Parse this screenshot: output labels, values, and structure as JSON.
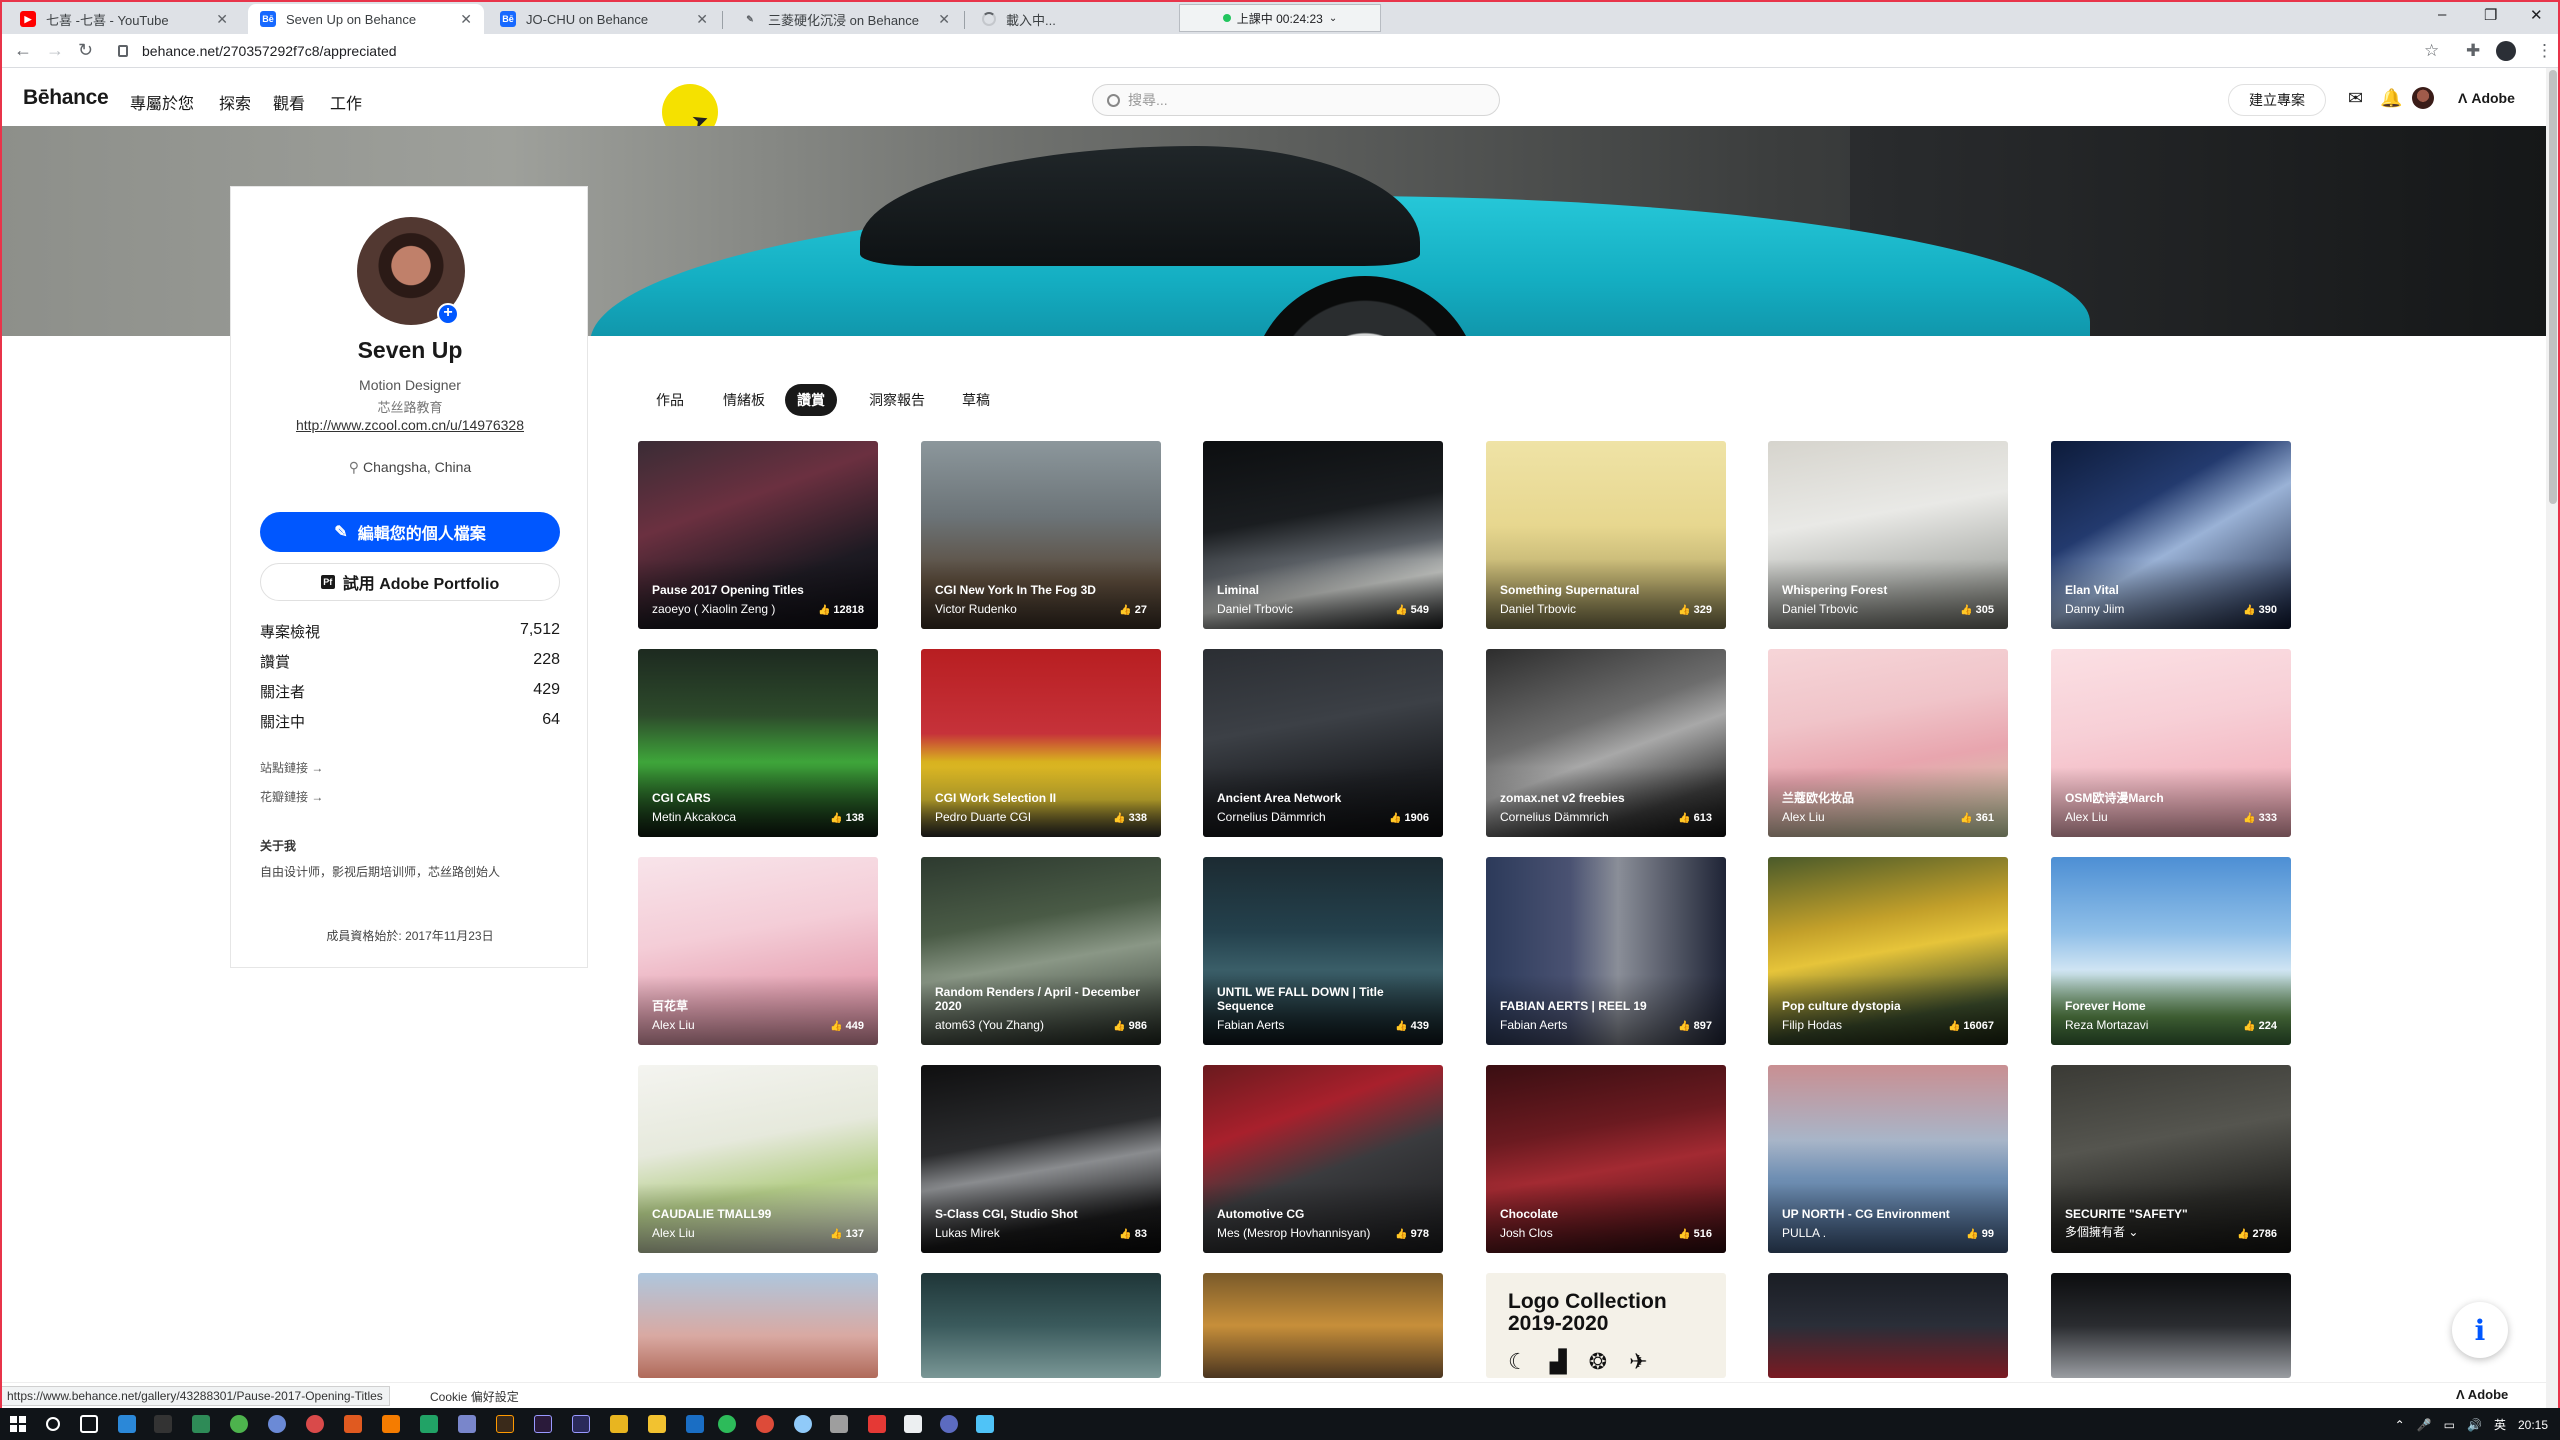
{
  "browser": {
    "tabs": [
      {
        "label": "七喜 -七喜 - YouTube",
        "favicon": "youtube-icon",
        "color": "#ff0000"
      },
      {
        "label": "Seven Up on Behance",
        "favicon": "behance-icon",
        "color": "#1769ff"
      },
      {
        "label": "JO-CHU on Behance",
        "favicon": "behance-icon",
        "color": "#1769ff"
      },
      {
        "label": "三菱硬化沉浸 on Behance",
        "favicon": "behance-icon",
        "color": "#1769ff"
      },
      {
        "label": "載入中...",
        "favicon": "loading-spinner"
      }
    ],
    "recording": "上課中 00:24:23",
    "url": "behance.net/270357292f7c8/appreciated",
    "status_url": "https://www.behance.net/gallery/43288301/Pause-2017-Opening-Titles"
  },
  "header": {
    "logo": "Bēhance",
    "nav": [
      "專屬於您",
      "探索",
      "觀看",
      "工作"
    ],
    "search_placeholder": "搜尋...",
    "create_label": "建立專案",
    "adobe_label": "Adobe"
  },
  "profile": {
    "name": "Seven Up",
    "occupation": "Motion Designer",
    "company": "芯丝路教育",
    "link": "http://www.zcool.com.cn/u/14976328",
    "location": "Changsha, China",
    "edit_label": "編輯您的個人檔案",
    "portfolio_label": "試用 Adobe Portfolio",
    "stats": [
      {
        "label": "專案檢視",
        "value": "7,512"
      },
      {
        "label": "讚賞",
        "value": "228"
      },
      {
        "label": "關注者",
        "value": "429"
      },
      {
        "label": "關注中",
        "value": "64"
      }
    ],
    "site_link": "站點鏈接 →",
    "flower_link": "花瓣鏈接 →",
    "about_heading": "关于我",
    "about_text": "自由设计师，影视后期培训师，芯丝路创始人",
    "member_since": "成員資格始於: 2017年11月23日"
  },
  "tabs": [
    "作品",
    "情緒板",
    "讚賞",
    "洞察報告",
    "草稿"
  ],
  "active_tab": "讚賞",
  "gallery": [
    {
      "title": "Pause 2017 Opening Titles",
      "author": "zaoeyo ( Xiaolin Zeng )",
      "likes": "12818",
      "bg": "linear-gradient(160deg,#3a2c35 0%,#6b3040 35%,#1d1a22 70%,#0d0c12 100%)"
    },
    {
      "title": "CGI New York In The Fog 3D",
      "author": "Victor Rudenko",
      "likes": "27",
      "bg": "linear-gradient(180deg,#8c979c 0%,#6c7478 40%,#5a4a3a 75%,#3b3026 100%)"
    },
    {
      "title": "Liminal",
      "author": "Daniel Trbovic",
      "likes": "549",
      "bg": "linear-gradient(170deg,#0c0e10 0%,#1a1d20 40%,#5b6066 60%,#c7c9c6 75%,#181a1c 100%)"
    },
    {
      "title": "Something Supernatural",
      "author": "Daniel Trbovic",
      "likes": "329",
      "bg": "linear-gradient(180deg,#efe3a6 0%,#e7d78f 45%,#bcae6e 75%,#7f774c 100%)"
    },
    {
      "title": "Whispering Forest",
      "author": "Daniel Trbovic",
      "likes": "305",
      "bg": "linear-gradient(170deg,#d6d4cd 0%,#e9e9e6 40%,#b3b5b1 70%,#6a6b63 100%)"
    },
    {
      "title": "Elan Vital",
      "author": "Danny Jiim",
      "likes": "390",
      "bg": "linear-gradient(150deg,#0d1b3a 0%,#233a6e 35%,#9ab2d6 55%,#0c1631 100%)"
    },
    {
      "title": "CGI CARS",
      "author": "Metin Akcakoca",
      "likes": "138",
      "bg": "linear-gradient(180deg,#1d2a20 0%,#2d4a2b 35%,#3ea53a 60%,#0f1a10 100%)"
    },
    {
      "title": "CGI Work Selection II",
      "author": "Pedro Duarte CGI",
      "likes": "338",
      "bg": "linear-gradient(180deg,#b81e21 0%,#c6323a 45%,#d8b21f 60%,#e0c433 80%,#2b2b2b 100%)"
    },
    {
      "title": "Ancient Area Network",
      "author": "Cornelius Dämmrich",
      "likes": "1906",
      "bg": "linear-gradient(170deg,#2b2e33 0%,#3c4046 40%,#1d1f23 70%,#0d0e10 100%)"
    },
    {
      "title": "zomax.net v2 freebies",
      "author": "Cornelius Dämmrich",
      "likes": "613",
      "bg": "linear-gradient(160deg,#2d2d2d 0%,#6d6d6d 40%,#a8a8a8 55%,#3a3a3a 80%,#101010 100%)"
    },
    {
      "title": "兰蔻欧化妆品",
      "author": "Alex Liu",
      "likes": "361",
      "bg": "linear-gradient(170deg,#f6d5d8 0%,#f0c4c9 35%,#e8a5ae 60%,#c9d7a8 100%)"
    },
    {
      "title": "OSM欧诗漫March",
      "author": "Alex Liu",
      "likes": "333",
      "bg": "linear-gradient(170deg,#fbe0e4 0%,#f7cfd6 40%,#f3b9c3 70%,#e9a2ae 100%)"
    },
    {
      "title": "百花草",
      "author": "Alex Liu",
      "likes": "449",
      "bg": "linear-gradient(170deg,#f8e4ea 0%,#f4cdd7 40%,#e7a6b6 70%,#d88fa1 100%)"
    },
    {
      "title": "Random Renders / April - December 2020",
      "author": "atom63 (You Zhang)",
      "likes": "986",
      "bg": "linear-gradient(170deg,#2d3a2f 0%,#4a5b46 35%,#8a9786 55%,#1f261f 100%)"
    },
    {
      "title": "UNTIL WE FALL DOWN | Title Sequence",
      "author": "Fabian Aerts",
      "likes": "439",
      "bg": "linear-gradient(180deg,#1c2b32 0%,#24414d 40%,#3a5e68 60%,#0d161a 100%)"
    },
    {
      "title": "FABIAN AERTS | REEL 19",
      "author": "Fabian Aerts",
      "likes": "897",
      "bg": "linear-gradient(90deg,#2c3a5a 0%,#4a5272 35%,#8a8e98 55%,#1f2436 100%)"
    },
    {
      "title": "Pop culture dystopia",
      "author": "Filip Hodas",
      "likes": "16067",
      "bg": "linear-gradient(170deg,#4a5a2a 0%,#c3a02a 35%,#e6c43a 50%,#3a4a2a 80%,#1a2210 100%)"
    },
    {
      "title": "Forever Home",
      "author": "Reza Mortazavi",
      "likes": "224",
      "bg": "linear-gradient(180deg,#4d8fd4 0%,#8fbfe8 40%,#cfe4f3 60%,#5b8a4a 85%,#3a6a3a 100%)"
    },
    {
      "title": "CAUDALIE TMALL99",
      "author": "Alex Liu",
      "likes": "137",
      "bg": "linear-gradient(170deg,#f4f4f0 0%,#e6e9dc 40%,#b6cf8a 65%,#d9d8d2 100%)"
    },
    {
      "title": "S-Class CGI, Studio Shot",
      "author": "Lukas Mirek",
      "likes": "83",
      "bg": "linear-gradient(170deg,#0f0f10 0%,#2b2c2e 40%,#8a8c8f 55%,#1a1a1b 80%,#0a0a0a 100%)"
    },
    {
      "title": "Automotive CG",
      "author": "Mes (Mesrop Hovhannisyan)",
      "likes": "978",
      "bg": "linear-gradient(160deg,#6a1a1e 0%,#a8202c 30%,#3a3b3e 55%,#1a1a1c 100%)"
    },
    {
      "title": "Chocolate",
      "author": "Josh Clos",
      "likes": "516",
      "bg": "linear-gradient(170deg,#3a0e12 0%,#6b1a20 35%,#a32a32 55%,#2a0a0d 100%)"
    },
    {
      "title": "UP NORTH - CG Environment",
      "author": "PULLA .",
      "likes": "99",
      "bg": "linear-gradient(180deg,#c98f92 0%,#a8b5c8 40%,#6f8fb3 60%,#3f5a7f 100%)"
    },
    {
      "title": "SECURITE \"SAFETY\"",
      "author": "多個擁有者 ⌄",
      "likes": "2786",
      "bg": "linear-gradient(170deg,#3a3a35 0%,#55554f 40%,#2a2a27 70%,#141412 100%)"
    }
  ],
  "partial_row": [
    {
      "bg": "linear-gradient(180deg,#aec6dd 0%,#d9a9a2 60%,#b06a5a 100%)"
    },
    {
      "bg": "linear-gradient(180deg,#1f3638 0%,#3a5a5c 50%,#7a9796 100%)"
    },
    {
      "bg": "linear-gradient(180deg,#7a5a2a 0%,#c78f3a 50%,#4a3520 100%)"
    },
    {
      "logo_title": "Logo Collection 2019-2020",
      "glyphs": [
        "☾",
        "▟",
        "❂",
        "✈"
      ],
      "bg": "#f4f1e8"
    },
    {
      "bg": "linear-gradient(180deg,#1a1d24 0%,#2a2e38 50%,#7a1a22 100%)"
    },
    {
      "bg": "linear-gradient(180deg,#0c0d0f 0%,#2a2c30 50%,#9a9da2 100%)"
    }
  ],
  "accent": "#0057ff",
  "taskbar": {
    "time": "20:15",
    "ime": "英"
  }
}
